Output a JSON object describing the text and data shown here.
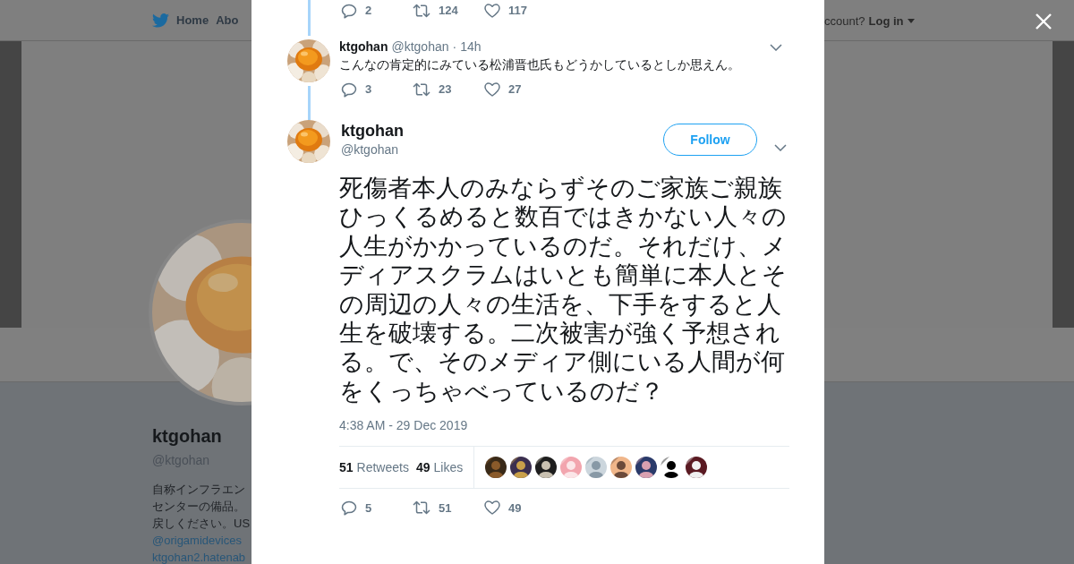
{
  "background_page": {
    "nav": {
      "items": [
        {
          "label": "Home",
          "kind": "home"
        },
        {
          "label": "Abo",
          "kind": "text"
        }
      ],
      "login_prompt": "ccount?",
      "login": "Log in"
    },
    "profile": {
      "name": "ktgohan",
      "handle": "@ktgohan",
      "bio_lines": [
        {
          "text": "自称インフラエン",
          "kind": "text"
        },
        {
          "text": "センターの備品。",
          "kind": "text"
        },
        {
          "text": "戻しください。US",
          "kind": "text"
        },
        {
          "text": "@origamidevices",
          "kind": "link"
        },
        {
          "text": "ktgohan2.hatenab",
          "kind": "link"
        }
      ]
    }
  },
  "modal": {
    "thread": [
      {
        "kind": "partial",
        "actions": {
          "replies": "2",
          "retweets": "124",
          "likes": "117"
        }
      },
      {
        "kind": "reply",
        "name": "ktgohan",
        "handle": "@ktgohan",
        "separator": "·",
        "time": "14h",
        "text": "こんなの肯定的にみている松浦晋也氏もどうかしているとしか思えん。",
        "actions": {
          "replies": "3",
          "retweets": "23",
          "likes": "27"
        }
      }
    ],
    "main_tweet": {
      "name": "ktgohan",
      "handle": "@ktgohan",
      "follow": "Follow",
      "text": "死傷者本人のみならずそのご家族ご親族ひっくるめると数百ではきかない人々の人生がかかっているのだ。それだけ、メディアスクラムはいとも簡単に本人とその周辺の人々の生活を、下手をすると人生を破壊する。二次被害が強く予想される。で、そのメディア側にいる人間が何をくっちゃべっているのだ？",
      "timestamp": "4:38 AM - 29 Dec 2019",
      "retweet_count": "51",
      "retweet_label": "Retweets",
      "like_count": "49",
      "like_label": "Likes",
      "actions": {
        "replies": "5",
        "retweets": "51",
        "likes": "49"
      }
    }
  }
}
